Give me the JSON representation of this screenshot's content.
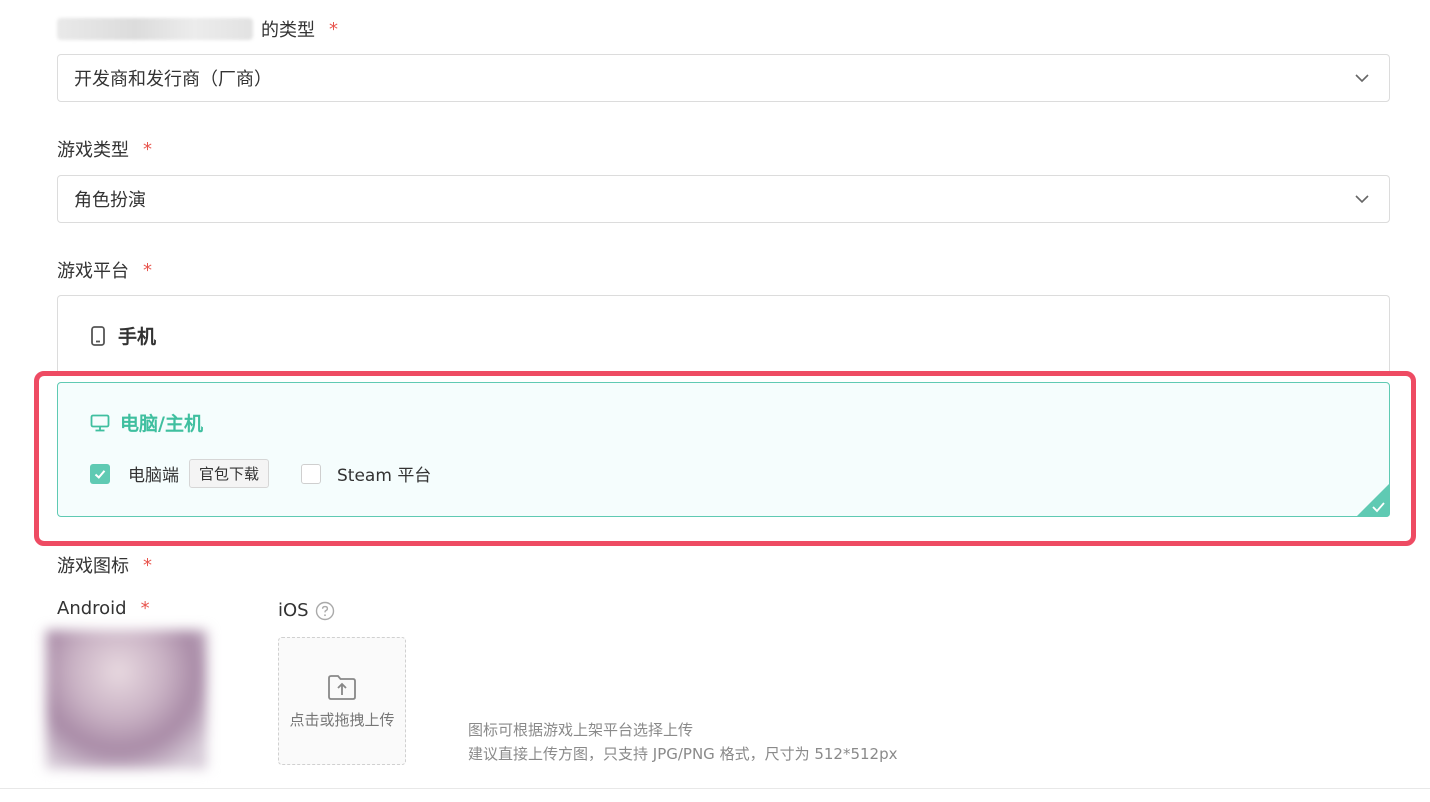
{
  "fields": {
    "entity_type": {
      "label_suffix": "的类型",
      "required_mark": "*",
      "value": "开发商和发行商（厂商）"
    },
    "game_type": {
      "label": "游戏类型",
      "required_mark": "*",
      "value": "角色扮演"
    },
    "game_platform": {
      "label": "游戏平台",
      "required_mark": "*",
      "mobile": {
        "title": "手机"
      },
      "pc": {
        "title": "电脑/主机",
        "options": [
          {
            "label": "电脑端",
            "tag": "官包下载",
            "checked": true
          },
          {
            "label": "Steam 平台",
            "checked": false
          }
        ]
      }
    },
    "game_icon": {
      "label": "游戏图标",
      "required_mark": "*",
      "android": {
        "label": "Android",
        "required_mark": "*"
      },
      "ios": {
        "label": "iOS",
        "help_icon": "question-circle-icon"
      },
      "upload_text": "点击或拖拽上传",
      "hint_line1": "图标可根据游戏上架平台选择上传",
      "hint_line2": "建议直接上传方图，只支持 JPG/PNG 格式，尺寸为 512*512px"
    }
  },
  "colors": {
    "accent": "#5fcab3",
    "required": "#e8554e",
    "highlight": "#ee4b63"
  }
}
